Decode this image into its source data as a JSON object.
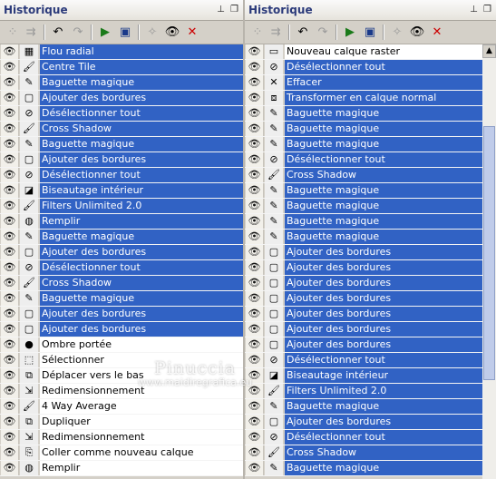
{
  "left_panel": {
    "title": "Historique",
    "rows": [
      {
        "label": "Flou radial",
        "icon": "radial-blur",
        "selected": true
      },
      {
        "label": "Centre Tile",
        "icon": "brush",
        "selected": true
      },
      {
        "label": "Baguette magique",
        "icon": "magic-wand",
        "selected": true
      },
      {
        "label": "Ajouter des bordures",
        "icon": "borders",
        "selected": true
      },
      {
        "label": "Désélectionner tout",
        "icon": "deselect",
        "selected": true
      },
      {
        "label": "Cross Shadow",
        "icon": "brush",
        "selected": true
      },
      {
        "label": "Baguette magique",
        "icon": "magic-wand",
        "selected": true
      },
      {
        "label": "Ajouter des bordures",
        "icon": "borders",
        "selected": true
      },
      {
        "label": "Désélectionner tout",
        "icon": "deselect",
        "selected": true
      },
      {
        "label": "Biseautage intérieur",
        "icon": "bevel",
        "selected": true
      },
      {
        "label": "Filters Unlimited 2.0",
        "icon": "brush",
        "selected": true
      },
      {
        "label": "Remplir",
        "icon": "fill",
        "selected": true
      },
      {
        "label": "Baguette magique",
        "icon": "magic-wand",
        "selected": true
      },
      {
        "label": "Ajouter des bordures",
        "icon": "borders",
        "selected": true
      },
      {
        "label": "Désélectionner tout",
        "icon": "deselect",
        "selected": true
      },
      {
        "label": "Cross Shadow",
        "icon": "brush",
        "selected": true
      },
      {
        "label": "Baguette magique",
        "icon": "magic-wand",
        "selected": true
      },
      {
        "label": "Ajouter des bordures",
        "icon": "borders",
        "selected": true
      },
      {
        "label": "Ajouter des bordures",
        "icon": "borders",
        "selected": true
      },
      {
        "label": "Ombre portée",
        "icon": "drop-shadow",
        "selected": false
      },
      {
        "label": "Sélectionner",
        "icon": "select",
        "selected": false
      },
      {
        "label": "Déplacer vers le bas",
        "icon": "move-down",
        "selected": false
      },
      {
        "label": "Redimensionnement",
        "icon": "resize",
        "selected": false
      },
      {
        "label": "4 Way Average",
        "icon": "brush",
        "selected": false
      },
      {
        "label": "Dupliquer",
        "icon": "duplicate",
        "selected": false
      },
      {
        "label": "Redimensionnement",
        "icon": "resize",
        "selected": false
      },
      {
        "label": "Coller comme nouveau calque",
        "icon": "paste-layer",
        "selected": false
      },
      {
        "label": "Remplir",
        "icon": "fill",
        "selected": false
      }
    ]
  },
  "right_panel": {
    "title": "Historique",
    "rows": [
      {
        "label": "Nouveau calque raster",
        "icon": "new-layer",
        "selected": false
      },
      {
        "label": "Désélectionner tout",
        "icon": "deselect",
        "selected": true
      },
      {
        "label": "Effacer",
        "icon": "erase",
        "selected": true
      },
      {
        "label": "Transformer en calque normal",
        "icon": "transform",
        "selected": true
      },
      {
        "label": "Baguette magique",
        "icon": "magic-wand",
        "selected": true
      },
      {
        "label": "Baguette magique",
        "icon": "magic-wand",
        "selected": true
      },
      {
        "label": "Baguette magique",
        "icon": "magic-wand",
        "selected": true
      },
      {
        "label": "Désélectionner tout",
        "icon": "deselect",
        "selected": true
      },
      {
        "label": "Cross Shadow",
        "icon": "brush",
        "selected": true
      },
      {
        "label": "Baguette magique",
        "icon": "magic-wand",
        "selected": true
      },
      {
        "label": "Baguette magique",
        "icon": "magic-wand",
        "selected": true
      },
      {
        "label": "Baguette magique",
        "icon": "magic-wand",
        "selected": true
      },
      {
        "label": "Baguette magique",
        "icon": "magic-wand",
        "selected": true
      },
      {
        "label": "Ajouter des bordures",
        "icon": "borders",
        "selected": true
      },
      {
        "label": "Ajouter des bordures",
        "icon": "borders",
        "selected": true
      },
      {
        "label": "Ajouter des bordures",
        "icon": "borders",
        "selected": true
      },
      {
        "label": "Ajouter des bordures",
        "icon": "borders",
        "selected": true
      },
      {
        "label": "Ajouter des bordures",
        "icon": "borders",
        "selected": true
      },
      {
        "label": "Ajouter des bordures",
        "icon": "borders",
        "selected": true
      },
      {
        "label": "Ajouter des bordures",
        "icon": "borders",
        "selected": true
      },
      {
        "label": "Désélectionner tout",
        "icon": "deselect",
        "selected": true
      },
      {
        "label": "Biseautage intérieur",
        "icon": "bevel",
        "selected": true
      },
      {
        "label": "Filters Unlimited 2.0",
        "icon": "brush",
        "selected": true
      },
      {
        "label": "Baguette magique",
        "icon": "magic-wand",
        "selected": true
      },
      {
        "label": "Ajouter des bordures",
        "icon": "borders",
        "selected": true
      },
      {
        "label": "Désélectionner tout",
        "icon": "deselect",
        "selected": true
      },
      {
        "label": "Cross Shadow",
        "icon": "brush",
        "selected": true
      },
      {
        "label": "Baguette magique",
        "icon": "magic-wand",
        "selected": true
      }
    ]
  },
  "watermark": {
    "name": "Pinuccia",
    "site": "www.maidiregrafica.eu"
  },
  "colors": {
    "selection": "#3162c4",
    "panel": "#d4d0c8",
    "title_text": "#2b3a7a"
  }
}
